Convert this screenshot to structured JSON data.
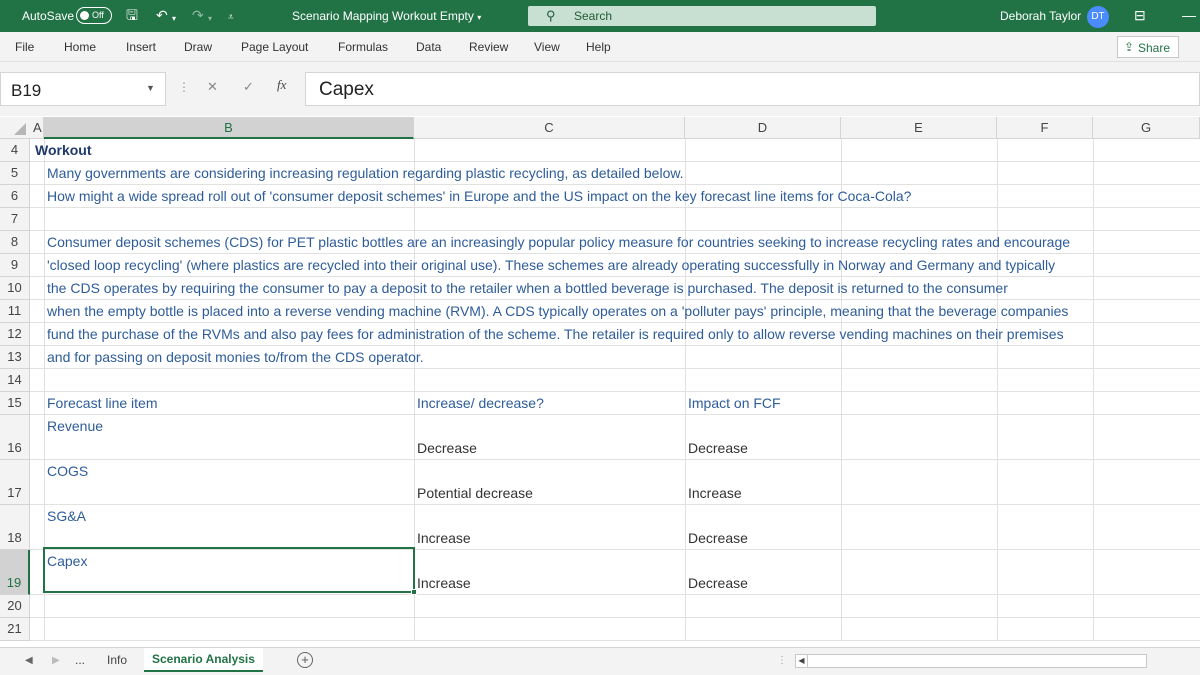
{
  "titlebar": {
    "autosave_label": "AutoSave",
    "autosave_state": "Off",
    "document_title": "Scenario Mapping Workout Empty",
    "search_placeholder": "Search",
    "user_name": "Deborah Taylor",
    "user_initials": "DT"
  },
  "ribbon": {
    "tabs": [
      "File",
      "Home",
      "Insert",
      "Draw",
      "Page Layout",
      "Formulas",
      "Data",
      "Review",
      "View",
      "Help"
    ],
    "share_label": "Share"
  },
  "formula_bar": {
    "name_box": "B19",
    "fx_label": "fx",
    "formula": "Capex"
  },
  "columns": [
    "A",
    "B",
    "C",
    "D",
    "E",
    "F",
    "G"
  ],
  "selected_column": "B",
  "rows": [
    {
      "num": "4",
      "cells": {
        "A": "Workout"
      }
    },
    {
      "num": "5",
      "cells": {
        "B": "Many governments are considering increasing regulation regarding plastic recycling, as detailed below."
      }
    },
    {
      "num": "6",
      "cells": {
        "B": "How might a wide spread roll out of 'consumer deposit schemes' in Europe and the US impact on the key forecast line items for Coca-Cola?"
      }
    },
    {
      "num": "7",
      "cells": {}
    },
    {
      "num": "8",
      "cells": {
        "B": "Consumer deposit schemes (CDS) for PET plastic bottles are an increasingly popular policy measure for countries seeking to increase recycling rates and encourage"
      }
    },
    {
      "num": "9",
      "cells": {
        "B": "'closed loop recycling' (where plastics are recycled into their original use).  These schemes are already operating successfully in Norway and Germany and typically"
      }
    },
    {
      "num": "10",
      "cells": {
        "B": "the CDS operates by requiring the consumer to pay a deposit to the retailer when a bottled beverage is purchased. The deposit is returned to the consumer"
      }
    },
    {
      "num": "11",
      "cells": {
        "B": "when the empty bottle is placed into a reverse vending machine (RVM). A CDS typically operates on a 'polluter pays' principle, meaning that the beverage companies"
      }
    },
    {
      "num": "12",
      "cells": {
        "B": "fund the purchase of the RVMs and also pay fees for administration of the scheme. The retailer is required only to allow reverse vending machines on their premises"
      }
    },
    {
      "num": "13",
      "cells": {
        "B": "and for passing on deposit monies to/from the CDS operator."
      }
    },
    {
      "num": "14",
      "cells": {}
    },
    {
      "num": "15",
      "cells": {
        "B": "Forecast line item",
        "C": "Increase/ decrease?",
        "D": "Impact on FCF"
      }
    },
    {
      "num": "16",
      "cells": {
        "B": "Revenue",
        "C": "Decrease",
        "D": "Decrease"
      }
    },
    {
      "num": "17",
      "cells": {
        "B": "COGS",
        "C": "Potential decrease",
        "D": "Increase"
      }
    },
    {
      "num": "18",
      "cells": {
        "B": "SG&A",
        "C": "Increase",
        "D": "Decrease"
      }
    },
    {
      "num": "19",
      "cells": {
        "B": "Capex",
        "C": "Increase",
        "D": "Decrease"
      }
    },
    {
      "num": "20",
      "cells": {}
    },
    {
      "num": "21",
      "cells": {}
    }
  ],
  "selected_row": "19",
  "sheets": {
    "overflow": "...",
    "tabs": [
      "Info",
      "Scenario Analysis"
    ],
    "active": "Scenario Analysis"
  }
}
